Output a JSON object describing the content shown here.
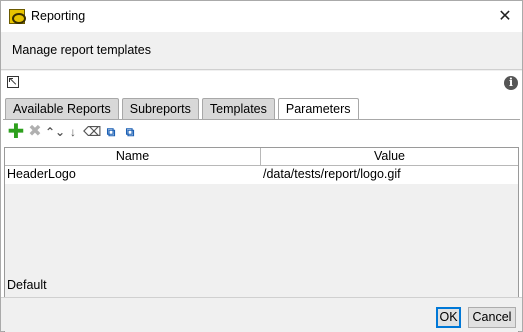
{
  "window": {
    "title": "Reporting",
    "app_icon": "report-icon",
    "close_glyph": "✕"
  },
  "header": {
    "text": "Manage report templates"
  },
  "icons": {
    "expand": "expand-icon",
    "info": "info-icon",
    "info_glyph": "i"
  },
  "tabs": [
    {
      "label": "Available Reports",
      "active": false
    },
    {
      "label": "Subreports",
      "active": false
    },
    {
      "label": "Templates",
      "active": false
    },
    {
      "label": "Parameters",
      "active": true
    }
  ],
  "toolbar": {
    "add_glyph": "✚",
    "remove_glyph": "✖",
    "up_glyph": "⌃⌄",
    "down_glyph": "↓",
    "erase_glyph": "⌫",
    "copy_glyph": "⧉",
    "paste_glyph": "⧉"
  },
  "table": {
    "columns": [
      "Name",
      "Value"
    ],
    "rows": [
      {
        "name": "HeaderLogo",
        "value": "/data/tests/report/logo.gif"
      }
    ]
  },
  "status": {
    "default_label": "Default"
  },
  "buttons": {
    "ok": "OK",
    "cancel": "Cancel"
  },
  "colors": {
    "add_green": "#2ea01e",
    "focus_blue": "#0078d7"
  }
}
